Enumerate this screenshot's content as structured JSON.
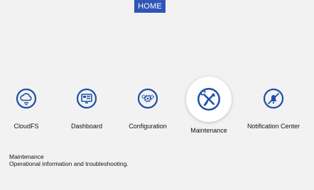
{
  "header": {
    "home_label": "HOME"
  },
  "launchers": [
    {
      "label": "CloudFS",
      "icon": "cloud-sync-icon"
    },
    {
      "label": "Dashboard",
      "icon": "monitor-dashboard-icon"
    },
    {
      "label": "Configuration",
      "icon": "gears-icon"
    },
    {
      "label": "Maintenance",
      "icon": "wrench-screwdriver-icon",
      "active": true
    },
    {
      "label": "Notification Center",
      "icon": "bell-muted-icon"
    }
  ],
  "description": {
    "title": "Maintenance",
    "text": "Operational information and troubleshooting."
  },
  "colors": {
    "accent": "#2f55b7",
    "icon": "#1f4fa8",
    "background": "#f2f2f2"
  }
}
